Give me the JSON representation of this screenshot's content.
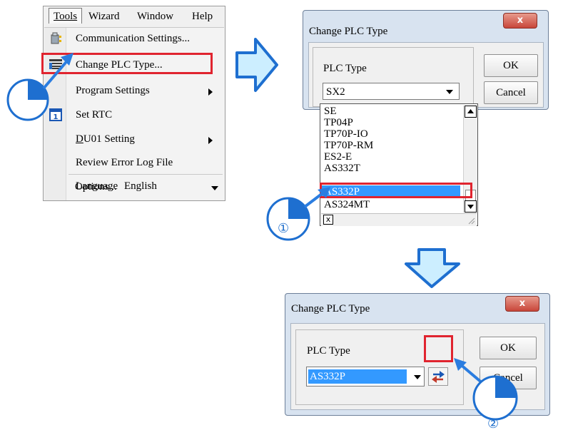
{
  "menu": {
    "bar": [
      "Tools",
      "Wizard",
      "Window",
      "Help"
    ],
    "items": [
      {
        "label": "Communication Settings...",
        "icon": "communication-icon"
      },
      {
        "label": "Change PLC Type...",
        "icon": "change-plc-type-icon"
      },
      {
        "label": "Program Settings",
        "submenu": true
      },
      {
        "label": "Set RTC",
        "icon": "calendar-icon"
      },
      {
        "label": "DU01 Setting",
        "submenu": true
      },
      {
        "label": "Review Error Log File"
      },
      {
        "label": "Language",
        "value": "English"
      },
      {
        "label": "Options..."
      }
    ]
  },
  "dialog1": {
    "title": "Change PLC Type",
    "close": "x",
    "group_label": "PLC Type",
    "current_value": "SX2",
    "ok": "OK",
    "cancel": "Cancel",
    "options": [
      "SE",
      "TP04P",
      "TP70P-IO",
      "TP70P-RM",
      "ES2-E",
      "AS332T",
      "AS332P",
      "AS324MT"
    ],
    "selected": "AS332P",
    "bottom_close": "x"
  },
  "dialog2": {
    "title": "Change PLC Type",
    "close": "x",
    "group_label": "PLC Type",
    "current_value": "AS332P",
    "ok": "OK",
    "cancel": "Cancel",
    "convert_icon": "swap-arrows-icon"
  },
  "steps": {
    "step1": "①",
    "step2": "②"
  },
  "colors": {
    "highlight": "#e0242f",
    "arrow_fill": "#cceeff",
    "arrow_stroke": "#1e6fd0",
    "selection": "#3399ff"
  }
}
